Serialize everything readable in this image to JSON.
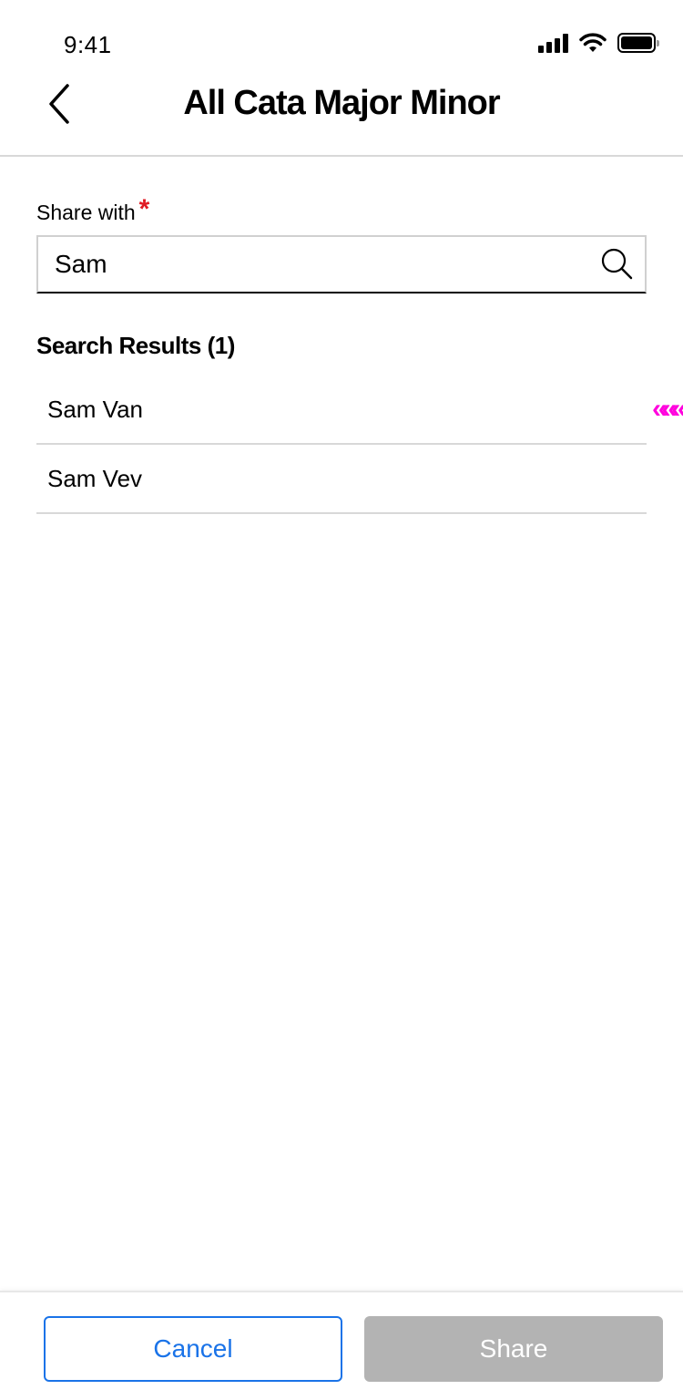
{
  "status_bar": {
    "time": "9:41",
    "icons": [
      "signal-icon",
      "wifi-icon",
      "battery-icon"
    ]
  },
  "header": {
    "back_icon": "chevron-left-icon",
    "title": "All Cata Major Minor"
  },
  "share_field": {
    "label": "Share with",
    "required_mark": "*",
    "value": "Sam",
    "search_icon": "search-icon"
  },
  "results": {
    "heading": "Search Results (1)",
    "items": [
      {
        "label": "Sam Van"
      },
      {
        "label": "Sam Vev"
      }
    ],
    "marker": "«««"
  },
  "footer": {
    "cancel_label": "Cancel",
    "share_label": "Share"
  },
  "colors": {
    "accent": "#1a73e8",
    "required": "#e01b24",
    "disabled_button": "#b3b3b3",
    "marker": "#ff00dd"
  }
}
